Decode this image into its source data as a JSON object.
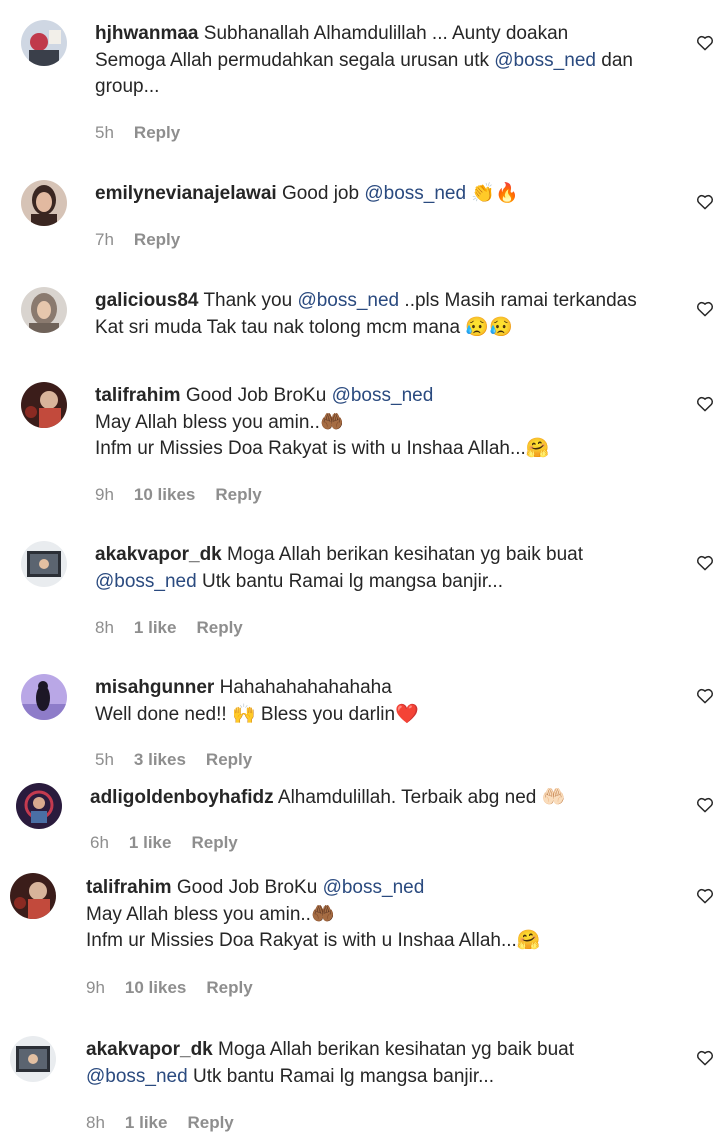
{
  "comments": [
    {
      "username": "hjhwanmaa",
      "parts": [
        "Subhanallah Alhamdulillah ... Aunty doakan\nSemoga Allah permudahkan segala urusan utk ",
        "@boss_ned",
        " dan\ngroup..."
      ],
      "time": "5h",
      "likes": "",
      "reply": "Reply",
      "avatar_colors": [
        "#cfd7e3",
        "#c0394b"
      ]
    },
    {
      "username": "emilynevianajelawai",
      "parts": [
        "Good job ",
        "@boss_ned",
        " 👏🔥"
      ],
      "time": "7h",
      "likes": "",
      "reply": "Reply",
      "avatar_colors": [
        "#d6c3b6",
        "#3a2621"
      ]
    },
    {
      "username": "galicious84",
      "parts": [
        "Thank you ",
        "@boss_ned",
        " ..pls Masih ramai terkandas\nKat sri muda Tak tau nak tolong mcm mana 😥😥"
      ],
      "time": "",
      "likes": "",
      "reply": "",
      "avatar_colors": [
        "#d9d4cf",
        "#8a7a6f"
      ]
    },
    {
      "username": "talifrahim",
      "parts": [
        "Good Job BroKu ",
        "@boss_ned",
        "\nMay Allah bless you amin..🤲🏾\nInfm ur Missies Doa Rakyat is with u Inshaa Allah...🤗"
      ],
      "time": "9h",
      "likes": "10 likes",
      "reply": "Reply",
      "avatar_colors": [
        "#3b1d1a",
        "#c24a3c"
      ]
    },
    {
      "username": "akakvapor_dk",
      "parts": [
        "Moga Allah berikan kesihatan yg baik buat\n",
        "@boss_ned",
        " Utk bantu Ramai lg mangsa banjir..."
      ],
      "time": "8h",
      "likes": "1 like",
      "reply": "Reply",
      "avatar_colors": [
        "#e9ecef",
        "#2b2f36"
      ]
    },
    {
      "username": "misahgunner",
      "parts": [
        "Hahahahahahahaha\nWell done ned!! 🙌 Bless you darlin❤️"
      ],
      "time": "5h",
      "likes": "3 likes",
      "reply": "Reply",
      "avatar_colors": [
        "#b9a7e6",
        "#1c1726"
      ]
    },
    {
      "username": "adligoldenboyhafidz",
      "parts": [
        "Alhamdulillah. Terbaik abg ned 🤲🏻"
      ],
      "time": "6h",
      "likes": "1 like",
      "reply": "Reply",
      "avatar_colors": [
        "#2a1b3d",
        "#c43a4f"
      ]
    },
    {
      "username": "talifrahim",
      "parts": [
        "Good Job BroKu ",
        "@boss_ned",
        "\nMay Allah bless you amin..🤲🏾\nInfm ur Missies Doa Rakyat is with u Inshaa Allah...🤗"
      ],
      "time": "9h",
      "likes": "10 likes",
      "reply": "Reply",
      "avatar_colors": [
        "#3b1d1a",
        "#c24a3c"
      ]
    },
    {
      "username": "akakvapor_dk",
      "parts": [
        "Moga Allah berikan kesihatan yg baik buat\n",
        "@boss_ned",
        " Utk bantu Ramai lg mangsa banjir..."
      ],
      "time": "8h",
      "likes": "1 like",
      "reply": "Reply",
      "avatar_colors": [
        "#e9ecef",
        "#2b2f36"
      ]
    }
  ],
  "colors": {
    "text": "#262626",
    "meta": "#8e8e8e",
    "mention": "#2a4a7f"
  },
  "icons": {
    "like": "heart-outline-icon"
  }
}
